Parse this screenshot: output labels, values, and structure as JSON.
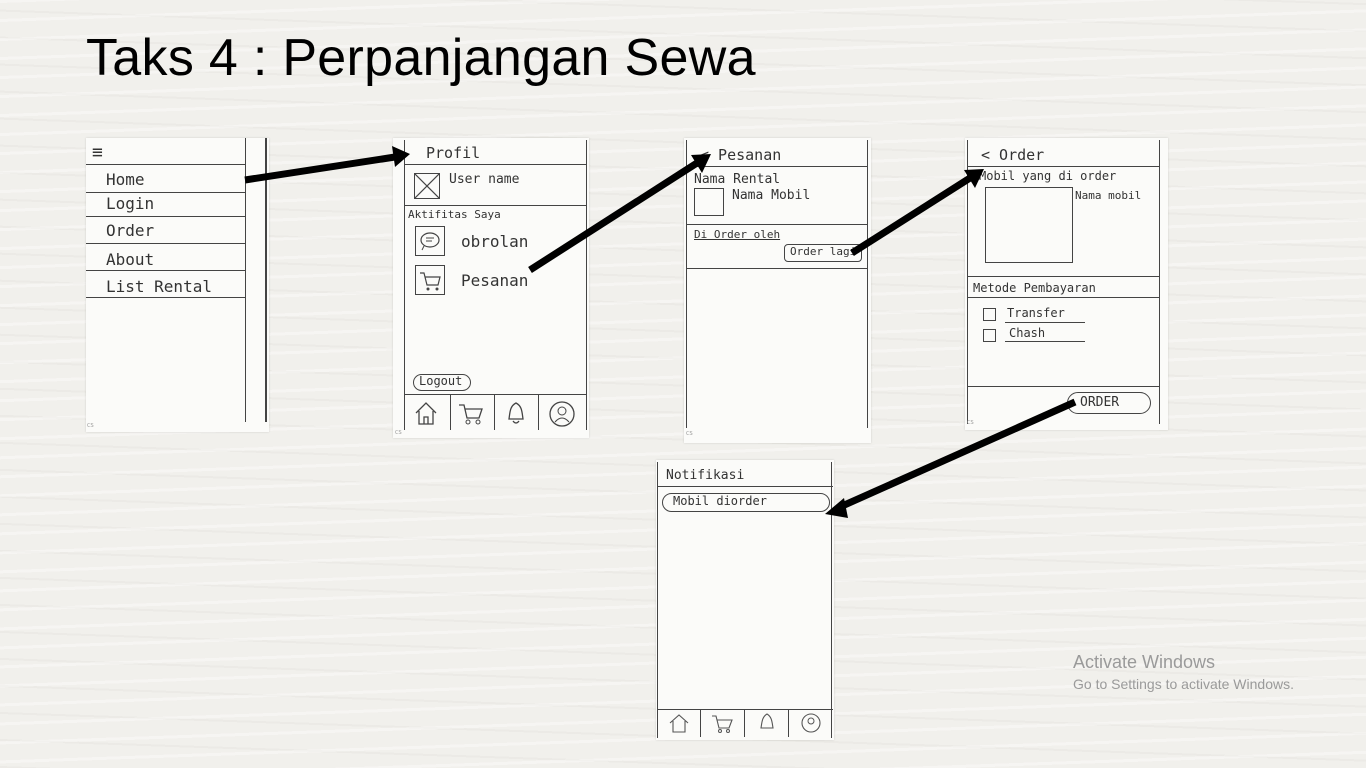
{
  "slide": {
    "title": "Taks 4 : Perpanjangan Sewa"
  },
  "menu_screen": {
    "hamburger_icon": "hamburger-icon",
    "items": [
      {
        "label": "Home"
      },
      {
        "label": "Login"
      },
      {
        "label": "Order"
      },
      {
        "label": "About"
      },
      {
        "label": "List Rental"
      }
    ]
  },
  "profile_screen": {
    "title": "Profil",
    "username": "User name",
    "section": "Aktifitas Saya",
    "activities": [
      {
        "icon": "chat-icon",
        "label": "obrolan"
      },
      {
        "icon": "cart-icon",
        "label": "Pesanan"
      }
    ],
    "logout": "Logout",
    "nav_icons": [
      "home-icon",
      "cart-icon",
      "bell-icon",
      "user-icon"
    ]
  },
  "pesanan_screen": {
    "title": "< Pesanan",
    "rental_name": "Nama Rental",
    "car_name": "Nama Mobil",
    "ordered_by": "Di Order oleh",
    "order_again": "Order lagi"
  },
  "order_screen": {
    "title": "< Order",
    "ordered_car_label": "Mobil yang di order",
    "car_name": "Nama mobil",
    "payment_label": "Metode Pembayaran",
    "payment_options": [
      {
        "label": "Transfer"
      },
      {
        "label": "Chash"
      }
    ],
    "order_button": "ORDER"
  },
  "notif_screen": {
    "title": "Notifikasi",
    "message": "Mobil diorder",
    "nav_icons": [
      "home-icon",
      "cart-icon",
      "bell-icon",
      "user-icon"
    ]
  },
  "watermark": {
    "line1": "Activate Windows",
    "line2": "Go to Settings to activate Windows."
  },
  "scanner_mark": "CS"
}
